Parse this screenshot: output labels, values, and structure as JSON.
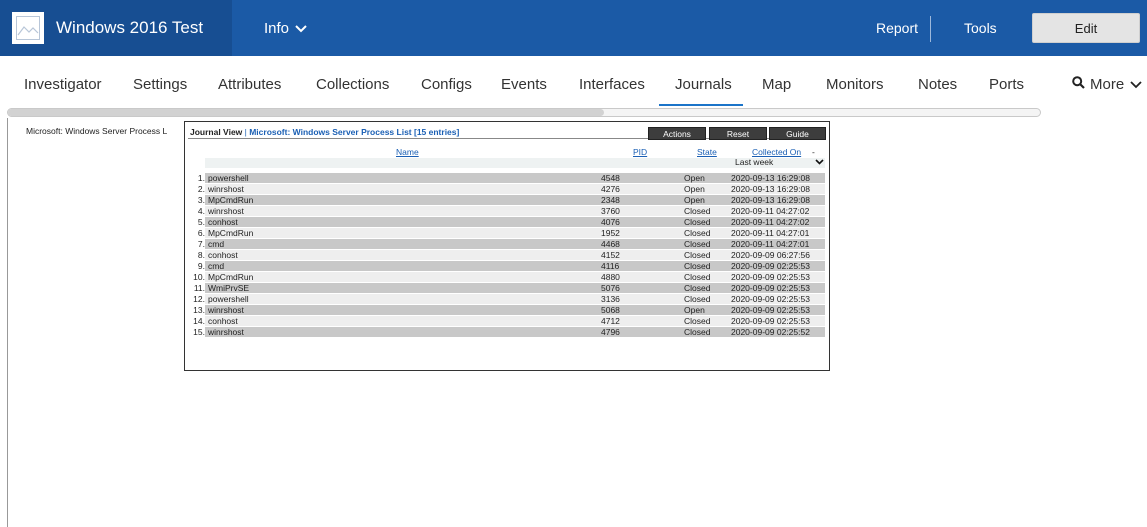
{
  "header": {
    "title": "Windows 2016 Test",
    "info_label": "Info",
    "report_label": "Report",
    "tools_label": "Tools",
    "edit_label": "Edit",
    "colors": {
      "bar": "#1b5aa6",
      "brand": "#174e92"
    }
  },
  "tabs": [
    {
      "label": "Investigator"
    },
    {
      "label": "Settings"
    },
    {
      "label": "Attributes"
    },
    {
      "label": "Collections"
    },
    {
      "label": "Configs"
    },
    {
      "label": "Events"
    },
    {
      "label": "Interfaces"
    },
    {
      "label": "Journals"
    },
    {
      "label": "Map"
    },
    {
      "label": "Monitors"
    },
    {
      "label": "Notes"
    },
    {
      "label": "Ports"
    }
  ],
  "active_tab": "Journals",
  "more_label": "More",
  "sidebar": {
    "item": "Microsoft: Windows Server Process L"
  },
  "journal": {
    "view_label": "Journal View",
    "separator": " | ",
    "list_title": "Microsoft: Windows Server Process List [15 entries]",
    "buttons": {
      "actions": "Actions",
      "reset": "Reset",
      "guide": "Guide"
    },
    "columns": {
      "name": "Name",
      "pid": "PID",
      "state": "State",
      "collected_on": "Collected On",
      "sort_mark": "-"
    },
    "filter": "Last week",
    "rows": [
      {
        "n": "1.",
        "name": "powershell",
        "pid": "4548",
        "state": "Open",
        "date": "2020-09-13 16:29:08"
      },
      {
        "n": "2.",
        "name": "winrshost",
        "pid": "4276",
        "state": "Open",
        "date": "2020-09-13 16:29:08"
      },
      {
        "n": "3.",
        "name": "MpCmdRun",
        "pid": "2348",
        "state": "Open",
        "date": "2020-09-13 16:29:08"
      },
      {
        "n": "4.",
        "name": "winrshost",
        "pid": "3760",
        "state": "Closed",
        "date": "2020-09-11 04:27:02"
      },
      {
        "n": "5.",
        "name": "conhost",
        "pid": "4076",
        "state": "Closed",
        "date": "2020-09-11 04:27:02"
      },
      {
        "n": "6.",
        "name": "MpCmdRun",
        "pid": "1952",
        "state": "Closed",
        "date": "2020-09-11 04:27:01"
      },
      {
        "n": "7.",
        "name": "cmd",
        "pid": "4468",
        "state": "Closed",
        "date": "2020-09-11 04:27:01"
      },
      {
        "n": "8.",
        "name": "conhost",
        "pid": "4152",
        "state": "Closed",
        "date": "2020-09-09 06:27:56"
      },
      {
        "n": "9.",
        "name": "cmd",
        "pid": "4116",
        "state": "Closed",
        "date": "2020-09-09 02:25:53"
      },
      {
        "n": "10.",
        "name": "MpCmdRun",
        "pid": "4880",
        "state": "Closed",
        "date": "2020-09-09 02:25:53"
      },
      {
        "n": "11.",
        "name": "WmiPrvSE",
        "pid": "5076",
        "state": "Closed",
        "date": "2020-09-09 02:25:53"
      },
      {
        "n": "12.",
        "name": "powershell",
        "pid": "3136",
        "state": "Closed",
        "date": "2020-09-09 02:25:53"
      },
      {
        "n": "13.",
        "name": "winrshost",
        "pid": "5068",
        "state": "Open",
        "date": "2020-09-09 02:25:53"
      },
      {
        "n": "14.",
        "name": "conhost",
        "pid": "4712",
        "state": "Closed",
        "date": "2020-09-09 02:25:53"
      },
      {
        "n": "15.",
        "name": "winrshost",
        "pid": "4796",
        "state": "Closed",
        "date": "2020-09-09 02:25:52"
      }
    ]
  }
}
